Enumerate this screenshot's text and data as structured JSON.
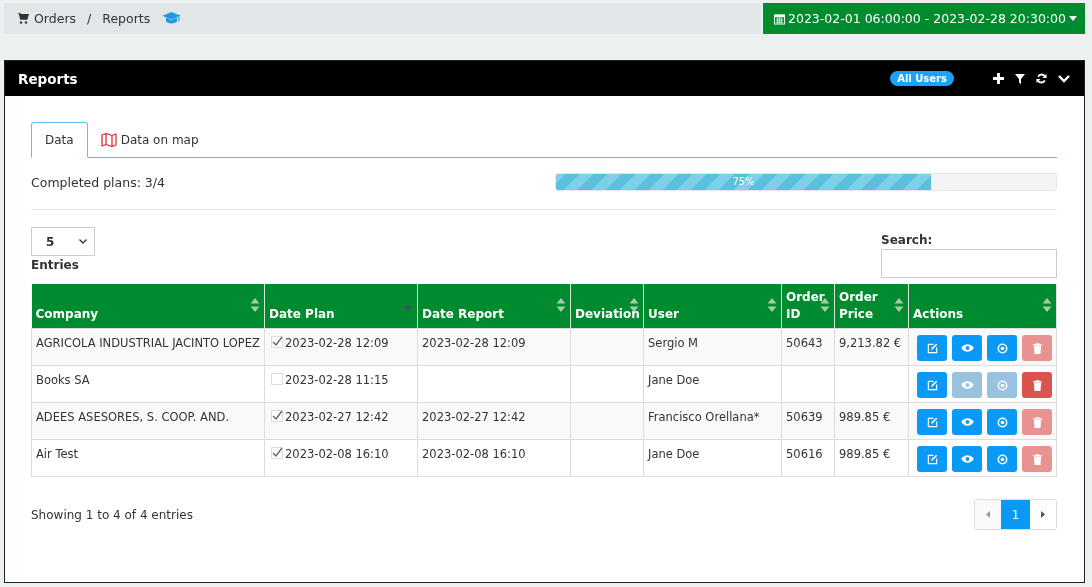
{
  "breadcrumb": {
    "items": [
      "Orders",
      "Reports"
    ],
    "separator": "/"
  },
  "date_range": {
    "label": "2023-02-01 06:00:00 - 2023-02-28 20:30:00"
  },
  "panel": {
    "title": "Reports",
    "badge": "All Users"
  },
  "tabs": [
    {
      "label": "Data",
      "selected": true,
      "kind": "plain"
    },
    {
      "label": "Data on map",
      "selected": false,
      "kind": "map"
    }
  ],
  "progress": {
    "label": "Completed plans: 3/4",
    "level": 0.75,
    "reading": "75%"
  },
  "entries": {
    "value": "5",
    "label": "Entries"
  },
  "search": {
    "label": "Search:"
  },
  "table": {
    "columns": [
      {
        "label": "Company",
        "kind": "sortable"
      },
      {
        "label": "Date Plan",
        "kind": "sorted"
      },
      {
        "label": "Date Report",
        "kind": "sortable"
      },
      {
        "label": "Deviation",
        "kind": "sortable"
      },
      {
        "label": "User",
        "kind": "sortable"
      },
      {
        "label": "Order ID",
        "kind": "sortable"
      },
      {
        "label": "Order Price",
        "kind": "sortable"
      },
      {
        "label": "Actions",
        "kind": "sortable"
      }
    ],
    "rows": [
      {
        "company": "AGRICOLA INDUSTRIAL JACINTO LOPEZ",
        "checked": true,
        "date_plan": "2023-02-28 12:09",
        "date_report": "2023-02-28 12:09",
        "user": "Sergio M",
        "order_id": "50643",
        "order_price": "9,213.82 €",
        "actions": [
          {
            "kind": "edit",
            "disabled": false
          },
          {
            "kind": "view",
            "disabled": false
          },
          {
            "kind": "target",
            "disabled": false
          },
          {
            "kind": "delete",
            "disabled": true
          }
        ]
      },
      {
        "company": "Books SA",
        "checked": false,
        "date_plan": "2023-02-28 11:15",
        "user": "Jane Doe",
        "actions": [
          {
            "kind": "edit",
            "disabled": false
          },
          {
            "kind": "view",
            "disabled": true
          },
          {
            "kind": "target",
            "disabled": true
          },
          {
            "kind": "delete",
            "disabled": false
          }
        ]
      },
      {
        "company": "ADEES ASESORES, S. COOP. AND.",
        "checked": true,
        "date_plan": "2023-02-27 12:42",
        "date_report": "2023-02-27 12:42",
        "user": "Francisco Orellana*",
        "order_id": "50639",
        "order_price": "989.85 €",
        "actions": [
          {
            "kind": "edit",
            "disabled": false
          },
          {
            "kind": "view",
            "disabled": false
          },
          {
            "kind": "target",
            "disabled": false
          },
          {
            "kind": "delete",
            "disabled": true
          }
        ]
      },
      {
        "company": "Air Test",
        "checked": true,
        "date_plan": "2023-02-08 16:10",
        "date_report": "2023-02-08 16:10",
        "user": "Jane Doe",
        "order_id": "50616",
        "order_price": "989.85 €",
        "actions": [
          {
            "kind": "edit",
            "disabled": false
          },
          {
            "kind": "view",
            "disabled": false
          },
          {
            "kind": "target",
            "disabled": false
          },
          {
            "kind": "delete",
            "disabled": true
          }
        ]
      }
    ]
  },
  "footer": {
    "info": "Showing 1 to 4 of 4 entries"
  },
  "pagination": {
    "prev_disabled": true,
    "pages": [
      {
        "label": "1",
        "selected": true
      }
    ],
    "next_disabled": false
  }
}
